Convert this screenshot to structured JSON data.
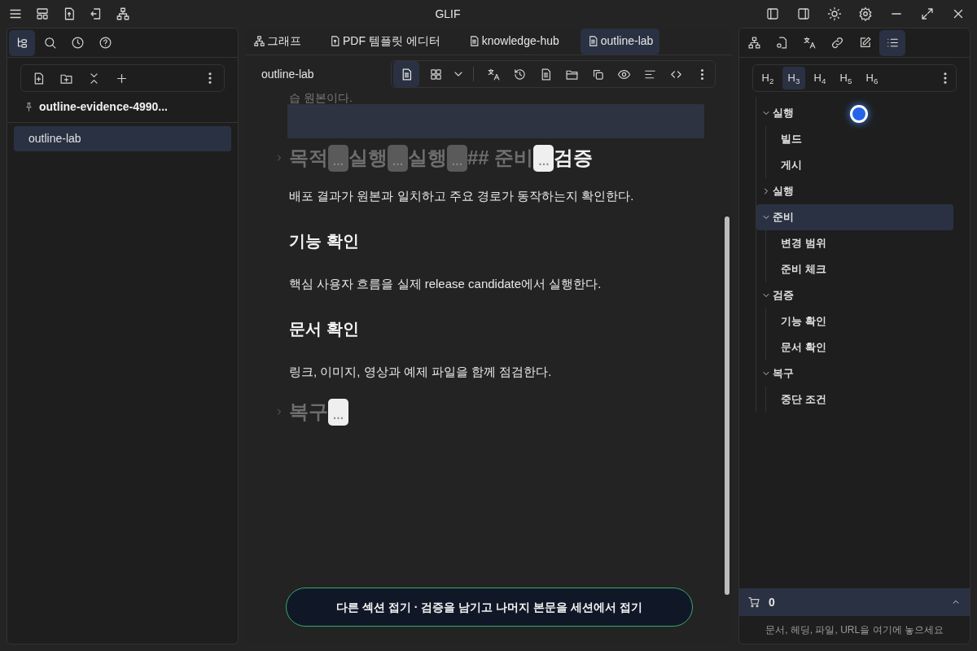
{
  "window": {
    "title": "GLIF"
  },
  "left_panel": {
    "tabs": [
      {
        "kind": "tree",
        "selected": true
      },
      {
        "kind": "search",
        "selected": false
      },
      {
        "kind": "clock",
        "selected": false
      },
      {
        "kind": "help",
        "selected": false
      }
    ],
    "folder_title": "outline-evidence-4990...",
    "files": [
      {
        "label": "outline-lab",
        "selected": true
      }
    ]
  },
  "editor_tabs": [
    {
      "kind": "graph",
      "label": "그래프",
      "selected": false
    },
    {
      "kind": "pdf",
      "label": "PDF 템플릿 에디터",
      "selected": false
    },
    {
      "kind": "doc",
      "label": "knowledge-hub",
      "selected": false
    },
    {
      "kind": "doc",
      "label": "outline-lab",
      "selected": true
    }
  ],
  "editor": {
    "title": "outline-lab",
    "view_modes": [
      {
        "kind": "doc",
        "selected": true
      },
      {
        "kind": "grid",
        "selected": false
      }
    ],
    "faded_line": "습 원본이다.",
    "blocks": [
      {
        "kind": "folded_heading",
        "segments": [
          {
            "kind": "text",
            "text": "목적",
            "dim": true
          },
          {
            "kind": "pill",
            "text": "…",
            "dim": true
          },
          {
            "kind": "text",
            "text": "실행",
            "dim": true
          },
          {
            "kind": "pill",
            "text": "…",
            "dim": true
          },
          {
            "kind": "text",
            "text": "실행",
            "dim": true
          },
          {
            "kind": "pill",
            "text": "…",
            "dim": true
          },
          {
            "kind": "text",
            "text": "## 준비",
            "dim": true
          },
          {
            "kind": "pill",
            "text": "…",
            "dim": false
          },
          {
            "kind": "text",
            "text": "검증",
            "dim": false
          }
        ]
      },
      {
        "kind": "paragraph",
        "text": "배포 결과가 원본과 일치하고 주요 경로가 동작하는지 확인한다."
      },
      {
        "kind": "heading",
        "text": "기능 확인"
      },
      {
        "kind": "paragraph",
        "text": "핵심 사용자 흐름을 실제 release candidate에서 실행한다."
      },
      {
        "kind": "heading",
        "text": "문서 확인"
      },
      {
        "kind": "paragraph",
        "text": "링크, 이미지, 영상과 예제 파일을 함께 점검한다."
      },
      {
        "kind": "folded_heading",
        "segments": [
          {
            "kind": "text",
            "text": "복구",
            "dim": true
          },
          {
            "kind": "pill",
            "text": "…",
            "dim": false
          }
        ]
      }
    ],
    "action_button": "다른 섹션 접기 · 검증을 남기고 나머지 본문을 세션에서 접기"
  },
  "right_panel": {
    "tabs": [
      {
        "kind": "graph",
        "selected": false
      },
      {
        "kind": "file-link",
        "selected": false
      },
      {
        "kind": "translate",
        "selected": false
      },
      {
        "kind": "link",
        "selected": false
      },
      {
        "kind": "edit",
        "selected": false
      },
      {
        "kind": "list",
        "selected": true
      }
    ],
    "levels": [
      {
        "label": "H$_{2}$",
        "selected": false
      },
      {
        "label": "H$_{3}$",
        "selected": true
      },
      {
        "label": "H$_{4}$",
        "selected": false
      },
      {
        "label": "H$_{5}$",
        "selected": false
      },
      {
        "label": "H$_{6}$",
        "selected": false
      }
    ],
    "outline": [
      {
        "label": "실행",
        "expanded": true,
        "selected": false,
        "children": [
          {
            "label": "빌드"
          },
          {
            "label": "게시"
          }
        ]
      },
      {
        "label": "실행",
        "expanded": false,
        "selected": false
      },
      {
        "label": "준비",
        "expanded": true,
        "selected": true,
        "children": [
          {
            "label": "변경 범위"
          },
          {
            "label": "준비 체크"
          }
        ]
      },
      {
        "label": "검증",
        "expanded": true,
        "selected": false,
        "children": [
          {
            "label": "기능 확인"
          },
          {
            "label": "문서 확인"
          }
        ]
      },
      {
        "label": "복구",
        "expanded": true,
        "selected": false,
        "children": [
          {
            "label": "중단 조건"
          }
        ]
      }
    ],
    "cart": {
      "count": "0",
      "hint": "문서, 헤딩, 파일, URL을 여기에 놓으세요"
    }
  }
}
